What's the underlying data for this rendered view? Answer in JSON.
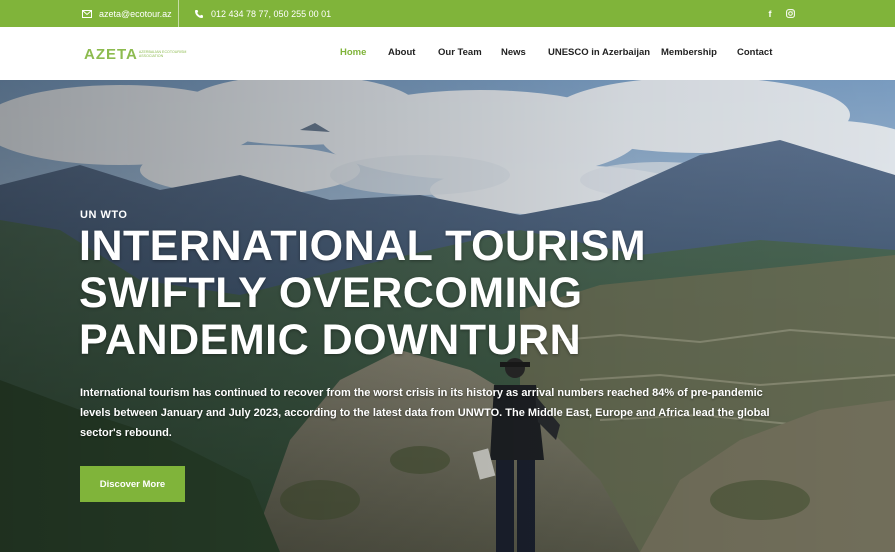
{
  "topbar": {
    "email": "azeta@ecotour.az",
    "email_icon": "mail-icon",
    "phone": "012 434 78 77, 050 255 00 01",
    "phone_icon": "phone-icon",
    "social": {
      "facebook": "f",
      "instagram": "instagram-icon"
    }
  },
  "brand": {
    "name": "AZETA",
    "tagline": "AZERBAIJAN ECOTOURISM ASSOCIATION"
  },
  "nav": {
    "items": [
      "Home",
      "About",
      "Our Team",
      "News",
      "UNESCO in Azerbaijan",
      "Membership",
      "Contact"
    ],
    "active": "Home"
  },
  "hero": {
    "eyebrow": "UN WTO",
    "title_line1": "INTERNATIONAL TOURISM",
    "title_line2": "SWIFTLY OVERCOMING",
    "title_line3": "PANDEMIC DOWNTURN",
    "description": "International tourism has continued to recover from the worst crisis in its history as arrival numbers reached 84% of pre-pandemic levels between January and July 2023, according to the latest data from UNWTO. The Middle East, Europe and Africa lead the global sector's rebound.",
    "cta_label": "Discover More"
  },
  "colors": {
    "brand_green": "#80b43a",
    "nav_text": "#222222"
  }
}
